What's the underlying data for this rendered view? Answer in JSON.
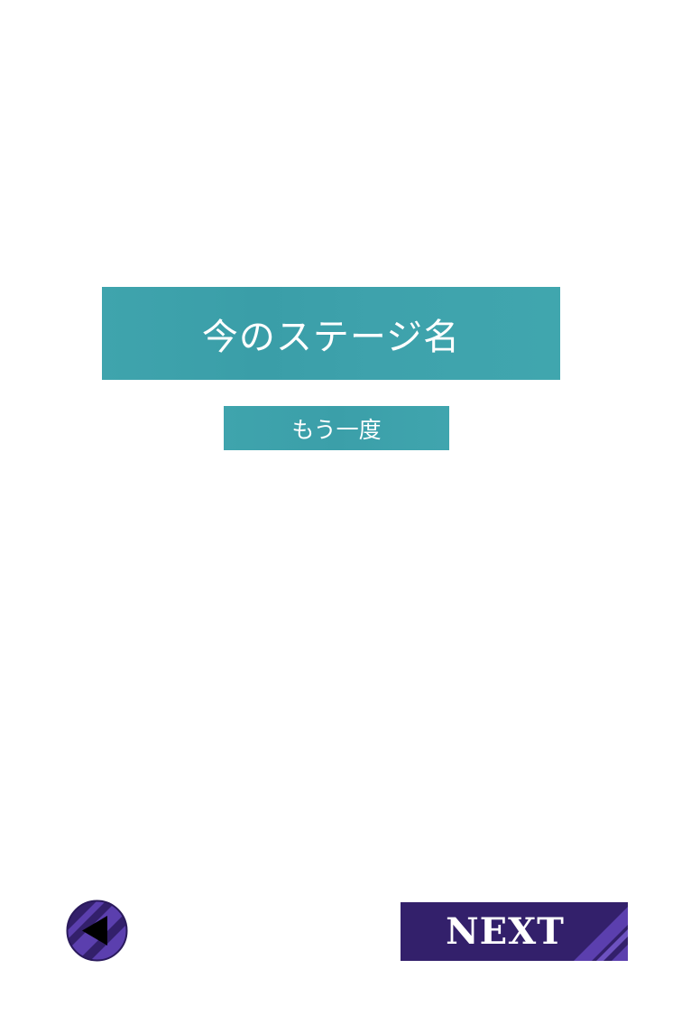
{
  "stage": {
    "title": "今のステージ名"
  },
  "actions": {
    "retry_label": "もう一度",
    "next_label": "NEXT",
    "back_icon": "back-arrow-icon"
  },
  "colors": {
    "teal": "#3fa4ad",
    "purple_dark": "#33206b",
    "purple_light": "#5b3fae",
    "white": "#ffffff",
    "black": "#000000"
  }
}
